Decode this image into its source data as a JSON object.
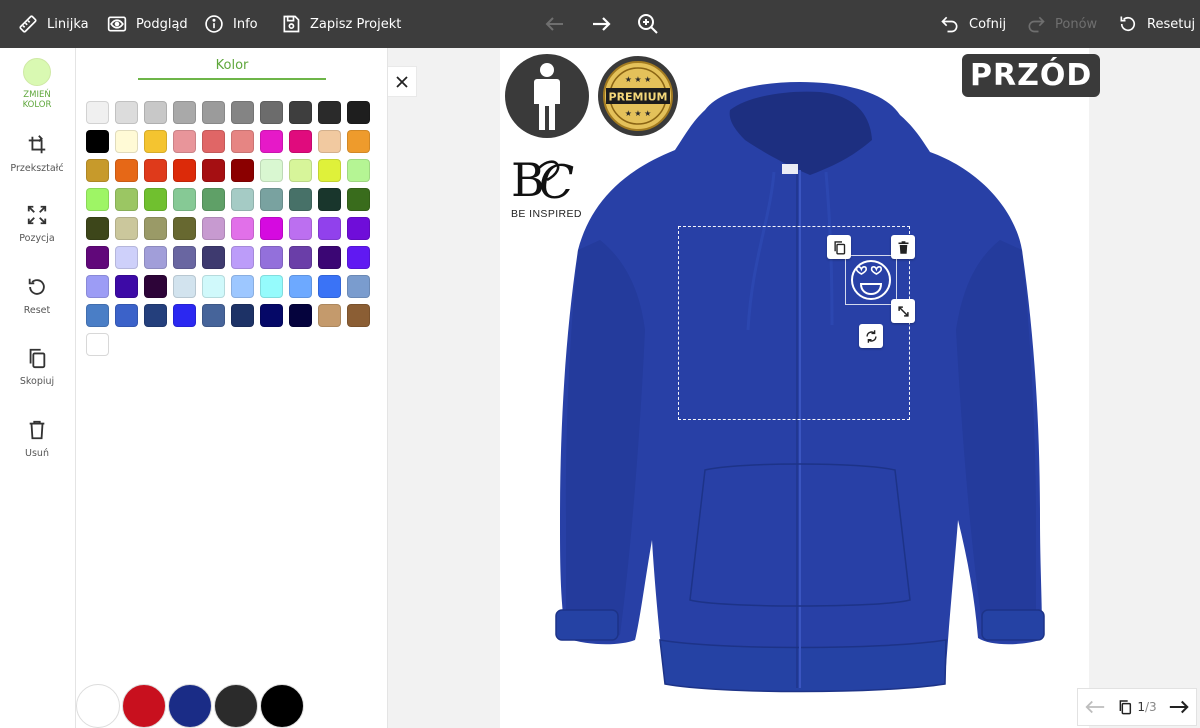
{
  "toolbar": {
    "ruler_label": "Linijka",
    "preview_label": "Podgląd",
    "info_label": "Info",
    "save_label": "Zapisz Projekt",
    "undo_label": "Cofnij",
    "redo_label": "Ponów",
    "reset_label": "Resetuj"
  },
  "rail": {
    "change_color_label_1": "ZMIEŃ",
    "change_color_label_2": "KOLOR",
    "current_color": "#d9f9b2",
    "items": [
      {
        "label": "Przekształć",
        "icon": "transform-icon"
      },
      {
        "label": "Pozycja",
        "icon": "position-icon"
      },
      {
        "label": "Reset",
        "icon": "reset-icon"
      },
      {
        "label": "Skopiuj",
        "icon": "copy-icon"
      },
      {
        "label": "Usuń",
        "icon": "trash-icon"
      }
    ]
  },
  "color_panel": {
    "tab_label": "Kolor",
    "swatches": [
      "#f0f0f0",
      "#dcdcdc",
      "#c8c8c8",
      "#a9a9a9",
      "#9b9b9b",
      "#848484",
      "#6c6c6c",
      "#3e3e3e",
      "#2a2a2a",
      "#1e1e1e",
      "#000000",
      "#fffad6",
      "#f4c430",
      "#e8959a",
      "#e06666",
      "#e68583",
      "#e619c8",
      "#e00b7d",
      "#f1c9a0",
      "#ee9b2c",
      "#c79a2b",
      "#e66817",
      "#df3a1b",
      "#dc2a09",
      "#a50f12",
      "#8b0000",
      "#d9f7d1",
      "#d7f59a",
      "#dff13a",
      "#b5f594",
      "#9ef565",
      "#9bc663",
      "#70c02f",
      "#86c995",
      "#5fa067",
      "#a5cbc5",
      "#79a2a0",
      "#477168",
      "#19362c",
      "#396c1c",
      "#3d461a",
      "#cbc79c",
      "#9a9a67",
      "#676830",
      "#c79ad0",
      "#e170e9",
      "#d50ae0",
      "#bc6ff0",
      "#9141ec",
      "#6f0dd9",
      "#61087a",
      "#ced0fa",
      "#a19ed9",
      "#6966a1",
      "#3e3a6f",
      "#bc9cf9",
      "#9370db",
      "#6a3ea8",
      "#3b0674",
      "#6019f2",
      "#9c9cf5",
      "#3d0aa6",
      "#2d0438",
      "#d2e3ee",
      "#d0f9fb",
      "#9dc7ff",
      "#95fbfc",
      "#6da9ff",
      "#3a73f6",
      "#7a9cce",
      "#4a7ec6",
      "#3b62c9",
      "#243f7c",
      "#2b28f1",
      "#46649a",
      "#1d3266",
      "#050867",
      "#05033d",
      "#c49a6c",
      "#8b5e34",
      "#ffffff"
    ],
    "quick_colors": [
      "#ffffff",
      "#c8101e",
      "#1a2c86",
      "#2b2b2b",
      "#000000"
    ]
  },
  "canvas": {
    "side_label": "PRZÓD",
    "premium_label": "PREMIUM",
    "brand_logo": "B&C",
    "brand_tagline": "BE INSPIRED",
    "garment_color": "#2840a6"
  },
  "pager": {
    "current": "1",
    "total": "/3"
  }
}
